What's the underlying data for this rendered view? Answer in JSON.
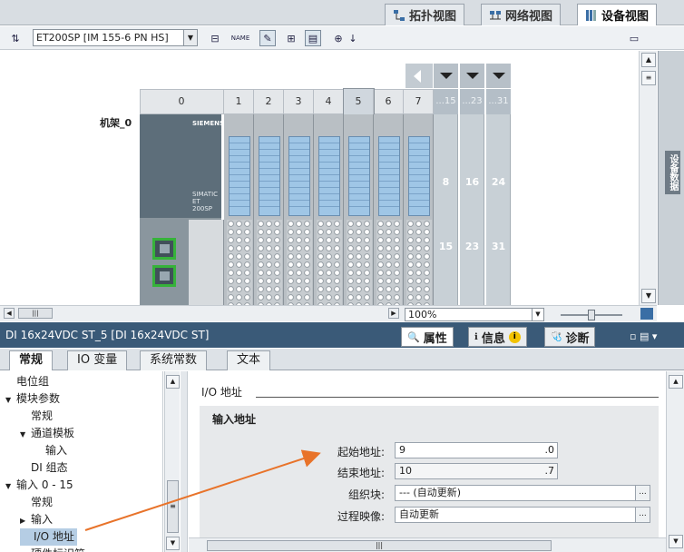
{
  "view_tabs": {
    "topology": "拓扑视图",
    "network": "网络视图",
    "device": "设备视图"
  },
  "toolbar": {
    "device_select": "ET200SP [IM 155-6 PN HS]",
    "name_label": "NAME"
  },
  "rack": {
    "name": "机架_0",
    "slots": [
      "0",
      "1",
      "2",
      "3",
      "4",
      "5",
      "6",
      "7"
    ],
    "ext_top_labels": [
      "...15",
      "...23",
      "...31"
    ],
    "ext_row1": [
      "8",
      "16",
      "24"
    ],
    "ext_row2": [
      "15",
      "23",
      "31"
    ],
    "brand": "SIEMENS",
    "head_text": "SIMATIC ET 200SP",
    "side_panel": "设备数据"
  },
  "zoom": {
    "value": "100%"
  },
  "properties": {
    "title": "DI 16x24VDC ST_5 [DI 16x24VDC ST]",
    "tabs": {
      "attributes": "属性",
      "info": "信息",
      "diagnostics": "诊断"
    },
    "subtabs": [
      "常规",
      "IO 变量",
      "系统常数",
      "文本"
    ]
  },
  "tree": [
    {
      "label": "电位组",
      "level": 0,
      "toggle": ""
    },
    {
      "label": "模块参数",
      "level": 0,
      "toggle": "▼"
    },
    {
      "label": "常规",
      "level": 1,
      "toggle": ""
    },
    {
      "label": "通道模板",
      "level": 1,
      "toggle": "▼"
    },
    {
      "label": "输入",
      "level": 2,
      "toggle": ""
    },
    {
      "label": "DI 组态",
      "level": 1,
      "toggle": ""
    },
    {
      "label": "输入 0 - 15",
      "level": 0,
      "toggle": "▼"
    },
    {
      "label": "常规",
      "level": 1,
      "toggle": ""
    },
    {
      "label": "输入",
      "level": 1,
      "toggle": "▶"
    },
    {
      "label": "I/O 地址",
      "level": 1,
      "toggle": "",
      "selected": true
    },
    {
      "label": "硬件标识符",
      "level": 1,
      "toggle": ""
    }
  ],
  "io": {
    "section": "I/O 地址",
    "input_section": "输入地址",
    "start_label": "起始地址:",
    "start_value": "9",
    "start_suffix": ".0",
    "end_label": "结束地址:",
    "end_value": "10",
    "end_suffix": ".7",
    "ob_label": "组织块:",
    "ob_value": "--- (自动更新)",
    "pi_label": "过程映像:",
    "pi_value": "自动更新",
    "more": "..."
  },
  "colors": {
    "title_bar": "#3a5a78",
    "arrow": "#e8732a",
    "port": "#36b23a",
    "selected_row": "#b5cde4"
  }
}
